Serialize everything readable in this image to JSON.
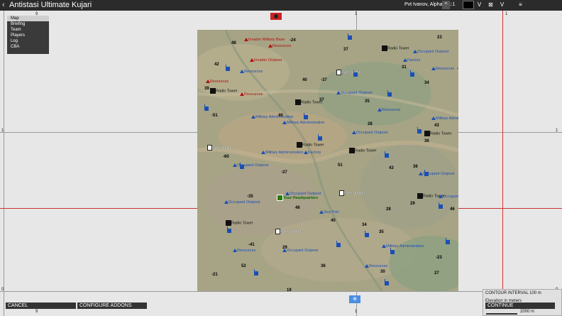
{
  "window": {
    "title": "Antistasi Ultimate Kujari",
    "back_glyph": "‹",
    "player": "Pvt Ivanov, Alpha 1-1:1"
  },
  "toolbar": {
    "up_icon": "^",
    "v_label1": "V",
    "x_label": "⊠",
    "v_label2": "V",
    "layers_icon": "layers-icon"
  },
  "menu": {
    "items": [
      "Map",
      "Briefing",
      "Team",
      "Players",
      "Log",
      "CBA"
    ],
    "selected": "Map"
  },
  "grid_labels": {
    "top_left": "9",
    "top_mid": "1",
    "top_right": "1",
    "left_mid": "1",
    "left_bottom": "0",
    "right_mid": "1",
    "bottom_left": "9",
    "bottom_mid": "1",
    "bottom_right": "1",
    "right_bottom": "0"
  },
  "buttons": {
    "cancel": "CANCEL",
    "configure": "CONFIGURE ADDONS",
    "continue": "CONTINUE"
  },
  "legend": {
    "contour": "CONTOUR INTERVAL 100 m",
    "elevation": "Elevation in meters",
    "scale": "2000 m"
  },
  "colors": {
    "occupant": "#1b4fb5",
    "invader": "#b01010",
    "hq": "#2d7a10",
    "red_grid": "#cc3333"
  },
  "markers": [
    {
      "type": "inv",
      "label": "Invader Military Base"
    },
    {
      "type": "inv",
      "label": "Resources"
    },
    {
      "type": "inv",
      "label": "Invader Outpost"
    },
    {
      "type": "inv",
      "label": "Resources"
    },
    {
      "type": "inv",
      "label": "Resources"
    },
    {
      "type": "radio",
      "label": "Radio Tower"
    },
    {
      "type": "radio",
      "label": "Radio Tower"
    },
    {
      "type": "radio",
      "label": "Radio Tower"
    },
    {
      "type": "radio",
      "label": "Radio Tower"
    },
    {
      "type": "radio",
      "label": "Radio Tower"
    },
    {
      "type": "radio",
      "label": "Radio Tower"
    },
    {
      "type": "radio",
      "label": "Radio Tower"
    },
    {
      "type": "radio",
      "label": "Radio Tower"
    },
    {
      "type": "fuel",
      "label": "Fuel Station"
    },
    {
      "type": "fuel",
      "label": "Fuel Station"
    },
    {
      "type": "fuel",
      "label": "Fuel Station"
    },
    {
      "type": "fuel",
      "label": "Fuel Station"
    },
    {
      "type": "out",
      "label": "Occupant Outpost"
    },
    {
      "type": "out",
      "label": "Occupant Outpost"
    },
    {
      "type": "out",
      "label": "Occupant Outpost"
    },
    {
      "type": "out",
      "label": "Occupant Outpost"
    },
    {
      "type": "out",
      "label": "Occupant Outpost"
    },
    {
      "type": "out",
      "label": "Occupant Outpost"
    },
    {
      "type": "out",
      "label": "Occupant Outpost"
    },
    {
      "type": "out",
      "label": "Occupant Outpost"
    },
    {
      "type": "out",
      "label": "Military Administration"
    },
    {
      "type": "out",
      "label": "Military Administration"
    },
    {
      "type": "out",
      "label": "Military Administration"
    },
    {
      "type": "out",
      "label": "Military Administration"
    },
    {
      "type": "out",
      "label": "Military Administration"
    },
    {
      "type": "out",
      "label": "Occupant Military Base"
    },
    {
      "type": "out",
      "label": "Factory"
    },
    {
      "type": "out",
      "label": "Factory"
    },
    {
      "type": "out",
      "label": "Sea Port"
    },
    {
      "type": "out",
      "label": "Resources"
    },
    {
      "type": "out",
      "label": "Resources"
    },
    {
      "type": "out",
      "label": "Resources"
    },
    {
      "type": "out",
      "label": "Resources"
    },
    {
      "type": "out",
      "label": "Resources"
    },
    {
      "type": "hq",
      "label": "Your Headquarters"
    }
  ],
  "elevations": [
    "48",
    "-24",
    "23",
    "37",
    "42",
    "-37",
    "31",
    "-23",
    "39",
    "40",
    "37",
    "34",
    "35",
    "-51",
    "40",
    "28",
    "43",
    "36",
    "-60",
    "51",
    "-37",
    "43",
    "36",
    "-35",
    "46",
    "28",
    "29",
    "46",
    "40",
    "34",
    "35",
    "-41",
    "29",
    "-23",
    "52",
    "36",
    "30",
    "27",
    "-21",
    "19"
  ]
}
